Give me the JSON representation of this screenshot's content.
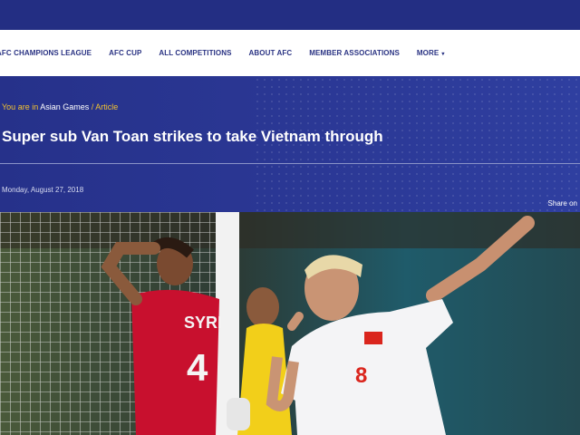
{
  "nav": {
    "items": [
      {
        "label": "AFC CHAMPIONS LEAGUE"
      },
      {
        "label": "AFC CUP"
      },
      {
        "label": "ALL COMPETITIONS"
      },
      {
        "label": "ABOUT AFC"
      },
      {
        "label": "MEMBER ASSOCIATIONS"
      },
      {
        "label": "MORE"
      }
    ],
    "more_caret": "▾"
  },
  "breadcrumb": {
    "prefix": "You are in",
    "section": "Asian Games",
    "current": "/ Article"
  },
  "article": {
    "title": "Super sub Van Toan strikes to take Vietnam through",
    "date": "Monday, August 27, 2018",
    "share_label": "Share on"
  },
  "photo": {
    "player_left_shirt_text": "SYRI",
    "player_left_number": "4",
    "player_right_number": "8"
  },
  "colors": {
    "brand_blue": "#232e83",
    "accent_yellow": "#f2c230",
    "syria_red": "#c8102e",
    "vietnam_white": "#f4f4f6"
  }
}
